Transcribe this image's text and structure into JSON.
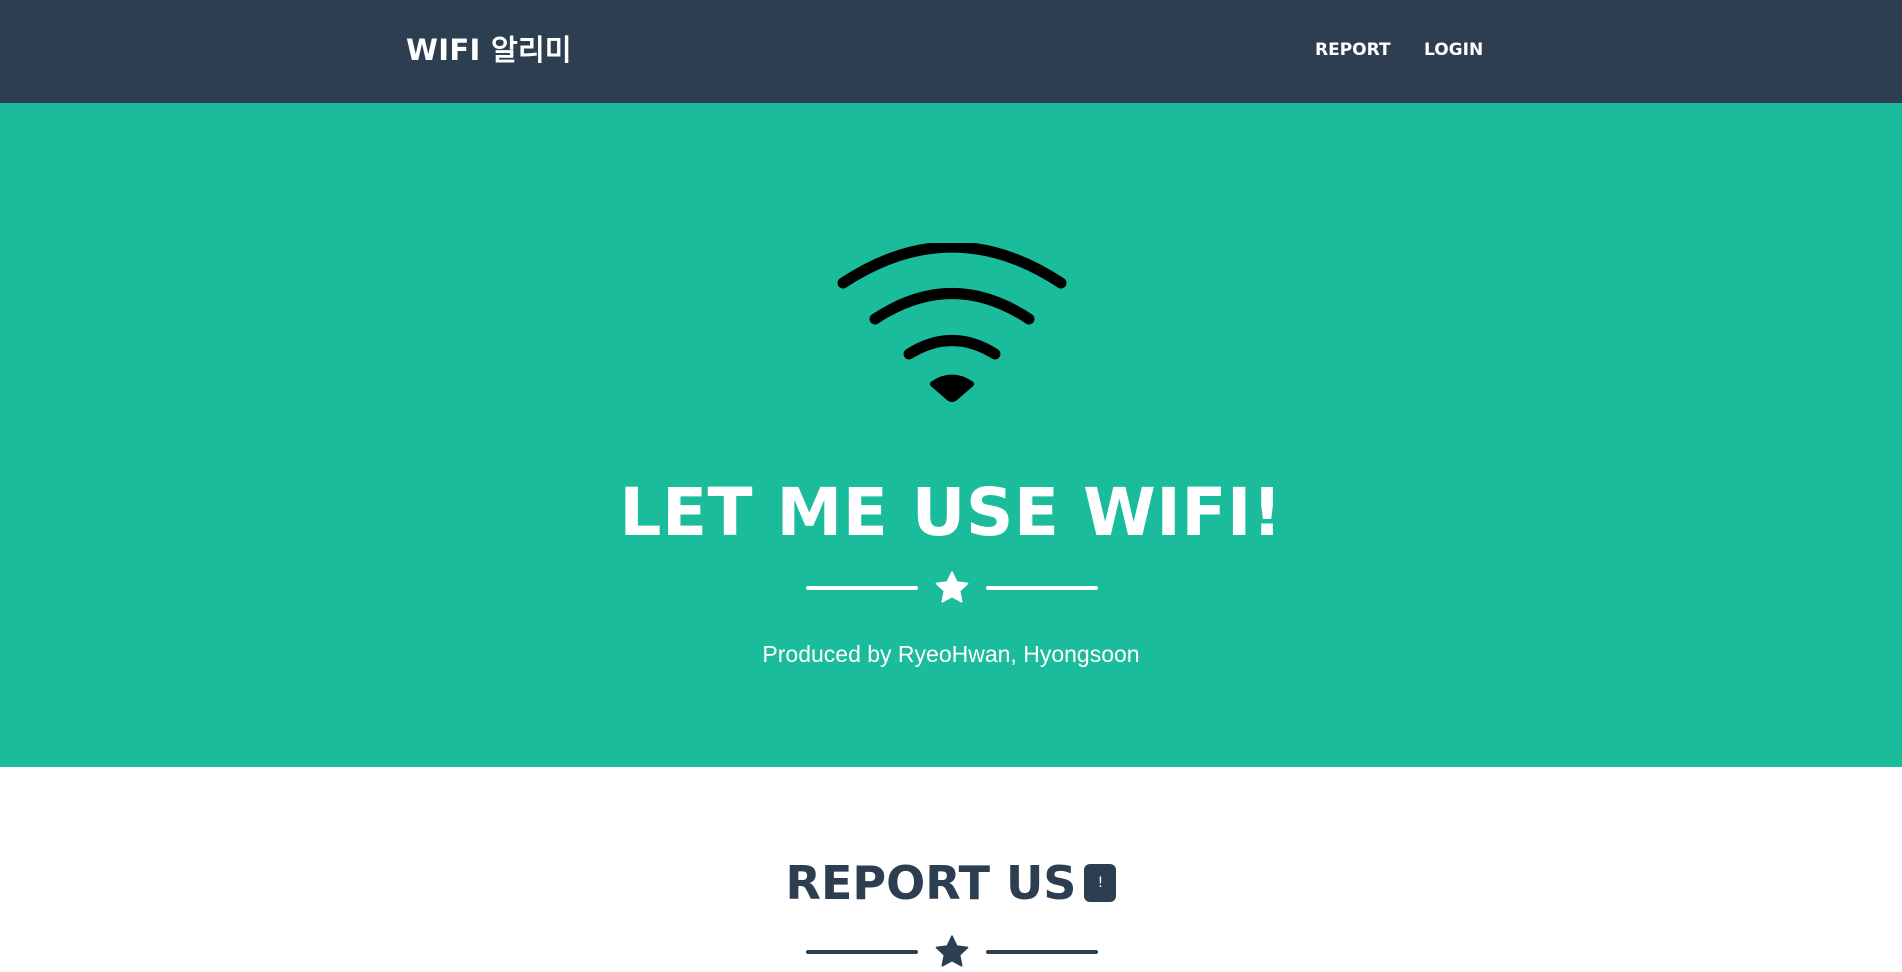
{
  "navbar": {
    "brand": "WIFI 알리미",
    "links": [
      {
        "label": "REPORT"
      },
      {
        "label": "LOGIN"
      }
    ]
  },
  "masthead": {
    "icon": "wifi-icon",
    "title": "LET ME USE WIFI!",
    "divider_icon": "star-icon",
    "subtitle": "Produced by RyeoHwan, Hyongsoon"
  },
  "report_section": {
    "title": "REPORT US",
    "badge": "!",
    "divider_icon": "star-icon"
  },
  "colors": {
    "navbar_bg": "#2c3e50",
    "masthead_bg": "#1abc9c",
    "text_light": "#ffffff",
    "text_dark": "#2c3e50"
  }
}
